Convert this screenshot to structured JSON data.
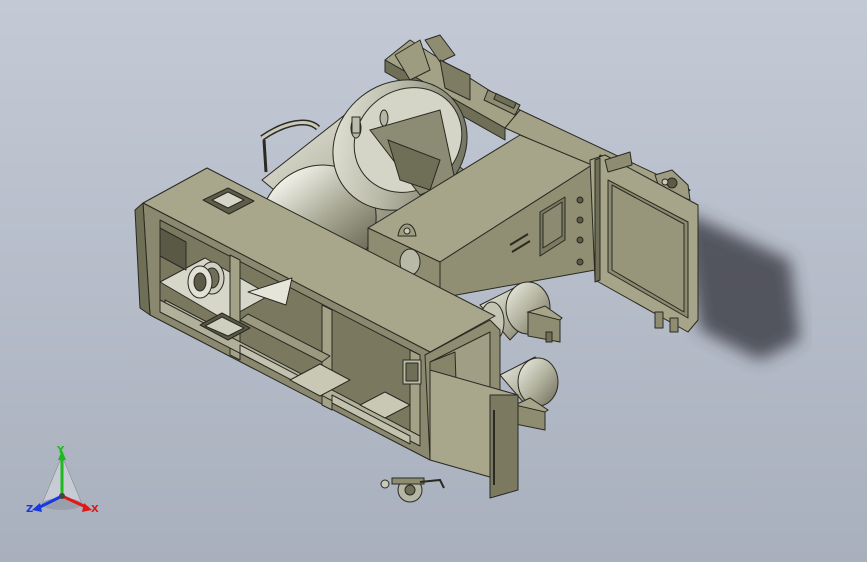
{
  "viewport": {
    "background_top": "#c3cad6",
    "background_bottom": "#a9b0bd"
  },
  "model": {
    "body_color": "#8e8d72",
    "body_light": "#a3a287",
    "body_dark": "#6f6e57",
    "edge_color": "#2a2a22",
    "metal_color": "#c9c9bb"
  },
  "triad": {
    "x_label": "X",
    "y_label": "Y",
    "z_label": "Z",
    "x_color": "#e01818",
    "y_color": "#1fb81f",
    "z_color": "#1838e0"
  }
}
